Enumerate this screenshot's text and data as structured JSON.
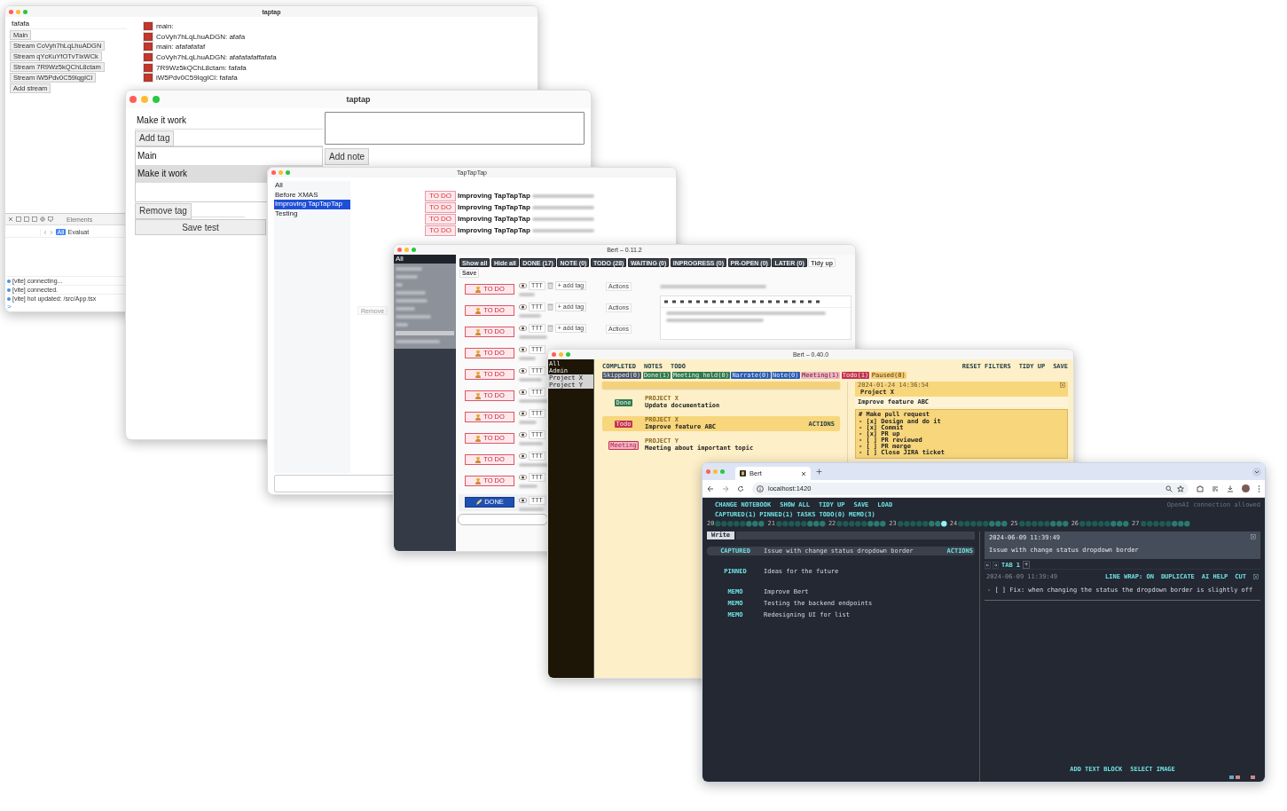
{
  "window_1": {
    "title": "taptap",
    "message_field": {
      "value": "fafafa"
    },
    "stream_buttons": [
      "Main",
      "Stream CoVyh7hLqLhuADGN",
      "Stream qYcKuYfOTvTlxWCk",
      "Stream 7R9Wz5kQChL8ctam",
      "Stream iW5Pdv0C59lqgICl",
      "Add stream"
    ],
    "messages": [
      "main:",
      "CoVyh7hLqLhuADGN: afafa",
      "main: afafafafaf",
      "CoVyh7hLqLhuADGN: afafafafaffafafa",
      "7R9Wz5kQChL8ctam: fafafa",
      "iW5Pdv0C59lqgICl: fafafa"
    ],
    "devtools": {
      "tab": "Elements",
      "filter": {
        "label": "All",
        "selected": true
      },
      "evaluate": "Evaluat",
      "console": [
        "[vite] connecting...",
        "[vite] connected.",
        "[vite] hot updated: /src/App.tsx"
      ],
      "prompt": ">"
    }
  },
  "window_2": {
    "title": "taptap",
    "note_title": {
      "value": "Make it work"
    },
    "add_tag_button": "Add tag",
    "tags": [
      {
        "label": "Main",
        "selected": false
      },
      {
        "label": "Make it work",
        "selected": true
      }
    ],
    "add_note_button": "Add note",
    "remove_tag_button": "Remove tag",
    "save_button": "Save test"
  },
  "window_3": {
    "title": "TapTapTap",
    "sidebar": [
      {
        "label": "All",
        "selected": false
      },
      {
        "label": "Before XMAS",
        "selected": false
      },
      {
        "label": "Improving TapTapTap",
        "selected": true
      },
      {
        "label": "Testing",
        "selected": false
      }
    ],
    "entries": [
      {
        "status": "TO DO",
        "project": "Improving TapTapTap"
      },
      {
        "status": "TO DO",
        "project": "Improving TapTapTap"
      },
      {
        "status": "TO DO",
        "project": "Improving TapTapTap"
      },
      {
        "status": "TO DO",
        "project": "Improving TapTapTap"
      }
    ],
    "remove_button": "Remove"
  },
  "window_4": {
    "title": "Bert – 0.11.2",
    "sidebar": [
      {
        "label": "All",
        "selected": true
      }
    ],
    "filters": [
      {
        "label": "Show all",
        "kind": "dark"
      },
      {
        "label": "Hide all",
        "kind": "dark"
      },
      {
        "label": "DONE (17)",
        "kind": "dark"
      },
      {
        "label": "NOTE (0)",
        "kind": "dark"
      },
      {
        "label": "TODO (28)",
        "kind": "dark"
      },
      {
        "label": "WAITING (0)",
        "kind": "dark"
      },
      {
        "label": "INPROGRESS (0)",
        "kind": "dark"
      },
      {
        "label": "PR-OPEN (0)",
        "kind": "dark"
      },
      {
        "label": "LATER (0)",
        "kind": "dark"
      },
      {
        "label": "Tidy up",
        "kind": "light"
      },
      {
        "label": "Save",
        "kind": "light"
      }
    ],
    "rows": [
      {
        "status": "TO DO",
        "kind": "todo",
        "format": "TTT",
        "tag": "+ add tag",
        "actions": "Actions"
      },
      {
        "status": "TO DO",
        "kind": "todo",
        "format": "TTT",
        "tag": "+ add tag",
        "actions": "Actions"
      },
      {
        "status": "TO DO",
        "kind": "todo",
        "format": "TTT",
        "tag": "+ add tag",
        "actions": "Actions"
      },
      {
        "status": "TO DO",
        "kind": "todo",
        "format": "TTT"
      },
      {
        "status": "TO DO",
        "kind": "todo",
        "format": "TTT"
      },
      {
        "status": "TO DO",
        "kind": "todo",
        "format": "TTT"
      },
      {
        "status": "TO DO",
        "kind": "todo",
        "format": "TTT"
      },
      {
        "status": "TO DO",
        "kind": "todo",
        "format": "TTT"
      },
      {
        "status": "TO DO",
        "kind": "todo",
        "format": "TTT"
      },
      {
        "status": "TO DO",
        "kind": "todo",
        "format": "TTT"
      },
      {
        "status": "DONE",
        "kind": "done",
        "format": "TTT"
      }
    ]
  },
  "window_5": {
    "title": "Bert – 0.40.0",
    "sidebar": [
      {
        "label": "All",
        "selected": false
      },
      {
        "label": "Admin",
        "selected": false
      },
      {
        "label": "Project X",
        "selected": true
      },
      {
        "label": "Project Y",
        "selected": true
      }
    ],
    "nav": [
      "COMPLETED",
      "NOTES",
      "TODO"
    ],
    "actions": [
      "RESET FILTERS",
      "TIDY UP",
      "SAVE"
    ],
    "tags": [
      {
        "label": "Skipped(0)",
        "color": "#4a5468"
      },
      {
        "label": "Done(1)",
        "color": "#2f7a4c"
      },
      {
        "label": "Meeting held(0)",
        "color": "#2f7a4c"
      },
      {
        "label": "Narrate(0)",
        "color": "#2a5db5"
      },
      {
        "label": "Note(0)",
        "color": "#2a5db5"
      },
      {
        "label": "Meeting(1)",
        "color": "#f2b3c6"
      },
      {
        "label": "Todo(1)",
        "color": "#c8324e"
      },
      {
        "label": "Paused(0)",
        "color": "#f3cf73"
      }
    ],
    "items": [
      {
        "status": "Done",
        "color": "#2f7a4c",
        "project": "PROJECT X",
        "title": "Update documentation",
        "selected": false
      },
      {
        "status": "Todo",
        "color": "#c8324e",
        "project": "PROJECT X",
        "title": "Improve feature ABC",
        "selected": true,
        "actions": "ACTIONS"
      },
      {
        "status": "Meeting",
        "color": "#f2b3c6",
        "project": "PROJECT Y",
        "title": "Meeting about important topic",
        "selected": false
      }
    ],
    "detail": {
      "timestamp": "2024-01-24 14:36:54",
      "project": "Project X",
      "title": "Improve feature ABC",
      "markdown": [
        "# Make pull request",
        "- [x] Design and do it",
        "- [x] Commit",
        "- [x] PR up",
        "- [ ] PR reviewed",
        "- [ ] PR merge",
        "- [ ] Close JIRA ticket"
      ]
    }
  },
  "window_6": {
    "tab_title": "Bert",
    "url": "localhost:1420",
    "nav": [
      "CHANGE NOTEBOOK",
      "SHOW ALL",
      "TIDY UP",
      "SAVE",
      "LOAD"
    ],
    "connection": "OpenAI connection allowed",
    "counts": [
      "CAPTURED(1)",
      "PINNED(1)",
      "TASKS TODO(0)",
      "MEMO(3)"
    ],
    "days": [
      {
        "label": "20",
        "selected": false
      },
      {
        "label": "21",
        "selected": false
      },
      {
        "label": "22",
        "selected": false
      },
      {
        "label": "23",
        "selected": true
      },
      {
        "label": "24",
        "selected": false
      },
      {
        "label": "25",
        "selected": false
      },
      {
        "label": "26",
        "selected": false
      },
      {
        "label": "27",
        "selected": false
      }
    ],
    "write_tab": "Write",
    "notes": [
      {
        "type": "CAPTURED",
        "title": "Issue with change status dropdown border",
        "selected": true,
        "actions": "ACTIONS"
      },
      {
        "type": "PINNED",
        "title": "Ideas for the future",
        "selected": false
      },
      {
        "type": "MEMO",
        "title": "Improve Bert",
        "selected": false
      },
      {
        "type": "MEMO",
        "title": "Testing the backend endpoints",
        "selected": false
      },
      {
        "type": "MEMO",
        "title": "Redesigning UI for list",
        "selected": false
      }
    ],
    "detail": {
      "timestamp": "2024-06-09 11:39:49",
      "title": "Issue with change status dropdown border",
      "tab": "TAB 1",
      "new_tab": "+",
      "block_timestamp": "2024-06-09 11:39:49",
      "block_actions": [
        "LINE WRAP: ON",
        "DUPLICATE",
        "AI HELP",
        "CUT"
      ],
      "block_text": "- [ ] Fix: when changing the status the dropdown border is slightly off"
    },
    "footer": [
      "ADD TEXT BLOCK",
      "SELECT IMAGE"
    ]
  }
}
